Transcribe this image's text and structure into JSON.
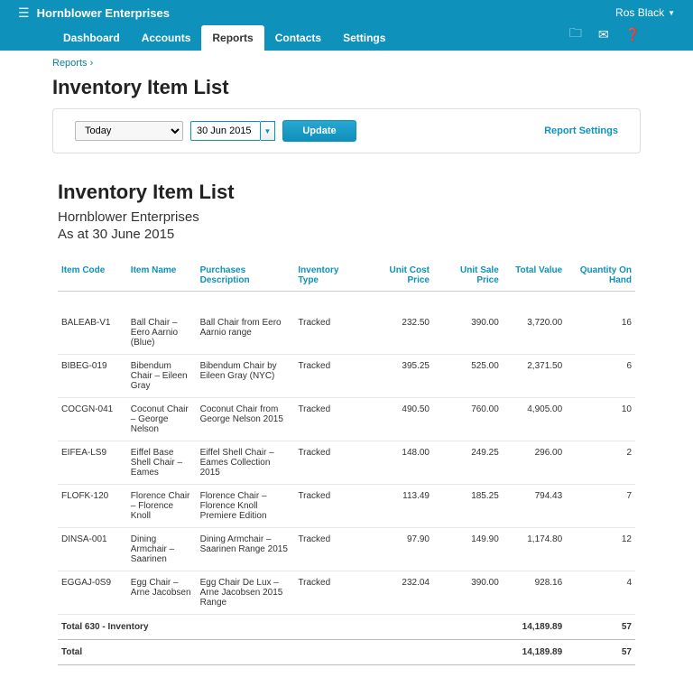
{
  "header": {
    "org": "Hornblower Enterprises",
    "user": "Ros Black"
  },
  "nav": {
    "tabs": [
      "Dashboard",
      "Accounts",
      "Reports",
      "Contacts",
      "Settings"
    ],
    "active": 2
  },
  "breadcrumb": {
    "link": "Reports"
  },
  "pageTitle": "Inventory Item List",
  "controls": {
    "periodSelect": "Today",
    "date": "30 Jun 2015",
    "updateBtn": "Update",
    "settingsLink": "Report Settings"
  },
  "report": {
    "title": "Inventory Item List",
    "org": "Hornblower Enterprises",
    "asAt": "As at 30 June 2015",
    "columns": [
      "Item Code",
      "Item Name",
      "Purchases Description",
      "Inventory Type",
      "Unit Cost Price",
      "Unit Sale Price",
      "Total Value",
      "Quantity On Hand"
    ],
    "rows": [
      {
        "code": "BALEAB-V1",
        "name": "Ball Chair – Eero Aarnio (Blue)",
        "desc": "Ball Chair from Eero Aarnio range",
        "type": "Tracked",
        "ucp": "232.50",
        "usp": "390.00",
        "tv": "3,720.00",
        "qty": "16"
      },
      {
        "code": "BIBEG-019",
        "name": "Bibendum Chair – Eileen Gray",
        "desc": "Bibendum Chair by Eileen Gray (NYC)",
        "type": "Tracked",
        "ucp": "395.25",
        "usp": "525.00",
        "tv": "2,371.50",
        "qty": "6"
      },
      {
        "code": "COCGN-041",
        "name": "Coconut Chair – George Nelson",
        "desc": "Coconut Chair from George Nelson 2015",
        "type": "Tracked",
        "ucp": "490.50",
        "usp": "760.00",
        "tv": "4,905.00",
        "qty": "10"
      },
      {
        "code": "EIFEA-LS9",
        "name": "Eiffel Base Shell Chair – Eames",
        "desc": "Eiffel Shell Chair – Eames Collection 2015",
        "type": "Tracked",
        "ucp": "148.00",
        "usp": "249.25",
        "tv": "296.00",
        "qty": "2"
      },
      {
        "code": "FLOFK-120",
        "name": "Florence Chair – Florence Knoll",
        "desc": "Florence Chair – Florence Knoll Premiere Edition",
        "type": "Tracked",
        "ucp": "113.49",
        "usp": "185.25",
        "tv": "794.43",
        "qty": "7"
      },
      {
        "code": "DINSA-001",
        "name": "Dining Armchair – Saarinen",
        "desc": "Dining Armchair – Saarinen Range 2015",
        "type": "Tracked",
        "ucp": "97.90",
        "usp": "149.90",
        "tv": "1,174.80",
        "qty": "12"
      },
      {
        "code": "EGGAJ-0S9",
        "name": "Egg Chair – Arne Jacobsen",
        "desc": "Egg Chair De Lux – Arne Jacobsen 2015 Range",
        "type": "Tracked",
        "ucp": "232.04",
        "usp": "390.00",
        "tv": "928.16",
        "qty": "4"
      }
    ],
    "subtotal": {
      "label": "Total 630 - Inventory",
      "tv": "14,189.89",
      "qty": "57"
    },
    "total": {
      "label": "Total",
      "tv": "14,189.89",
      "qty": "57"
    }
  }
}
